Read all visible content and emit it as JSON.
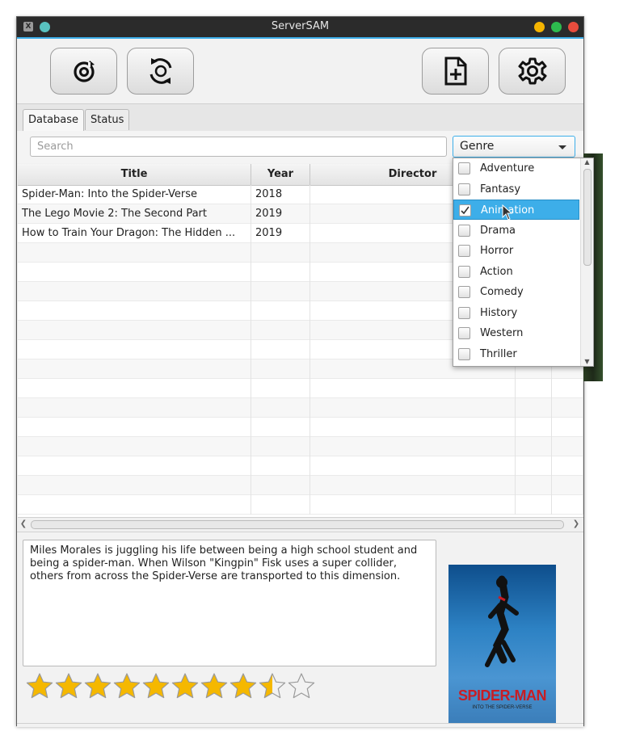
{
  "window": {
    "title": "ServerSAM"
  },
  "toolbar": {
    "buttons": [
      {
        "name": "refresh",
        "icon": "refresh-icon"
      },
      {
        "name": "sync",
        "icon": "sync-icon"
      },
      {
        "name": "add-file",
        "icon": "file-plus-icon"
      },
      {
        "name": "settings",
        "icon": "gear-icon"
      }
    ]
  },
  "tabs": [
    {
      "label": "Database",
      "active": true
    },
    {
      "label": "Status",
      "active": false
    }
  ],
  "search": {
    "placeholder": "Search",
    "value": ""
  },
  "genre_select": {
    "label": "Genre",
    "options": [
      {
        "label": "Adventure",
        "checked": false
      },
      {
        "label": "Fantasy",
        "checked": false
      },
      {
        "label": "Animation",
        "checked": true
      },
      {
        "label": "Drama",
        "checked": false
      },
      {
        "label": "Horror",
        "checked": false
      },
      {
        "label": "Action",
        "checked": false
      },
      {
        "label": "Comedy",
        "checked": false
      },
      {
        "label": "History",
        "checked": false
      },
      {
        "label": "Western",
        "checked": false
      },
      {
        "label": "Thriller",
        "checked": false
      }
    ]
  },
  "table": {
    "columns": [
      "Title",
      "Year",
      "Director"
    ],
    "rows": [
      {
        "title": "Spider-Man: Into the Spider-Verse",
        "year": "2018",
        "director": ""
      },
      {
        "title": "The Lego Movie 2: The Second Part",
        "year": "2019",
        "director": ""
      },
      {
        "title": "How to Train Your Dragon: The Hidden ...",
        "year": "2019",
        "director": ""
      }
    ]
  },
  "details": {
    "description": "Miles Morales is juggling his life between being a high school student and being a spider-man. When Wilson \"Kingpin\" Fisk uses a super collider, others from across the Spider-Verse are transported to this dimension.",
    "rating": {
      "value": 8.5,
      "max": 10
    },
    "poster": {
      "title": "SPIDER-MAN",
      "subtitle": "INTO THE SPIDER-VERSE"
    }
  },
  "colors": {
    "accent": "#3daee9",
    "star": "#f5b800"
  }
}
